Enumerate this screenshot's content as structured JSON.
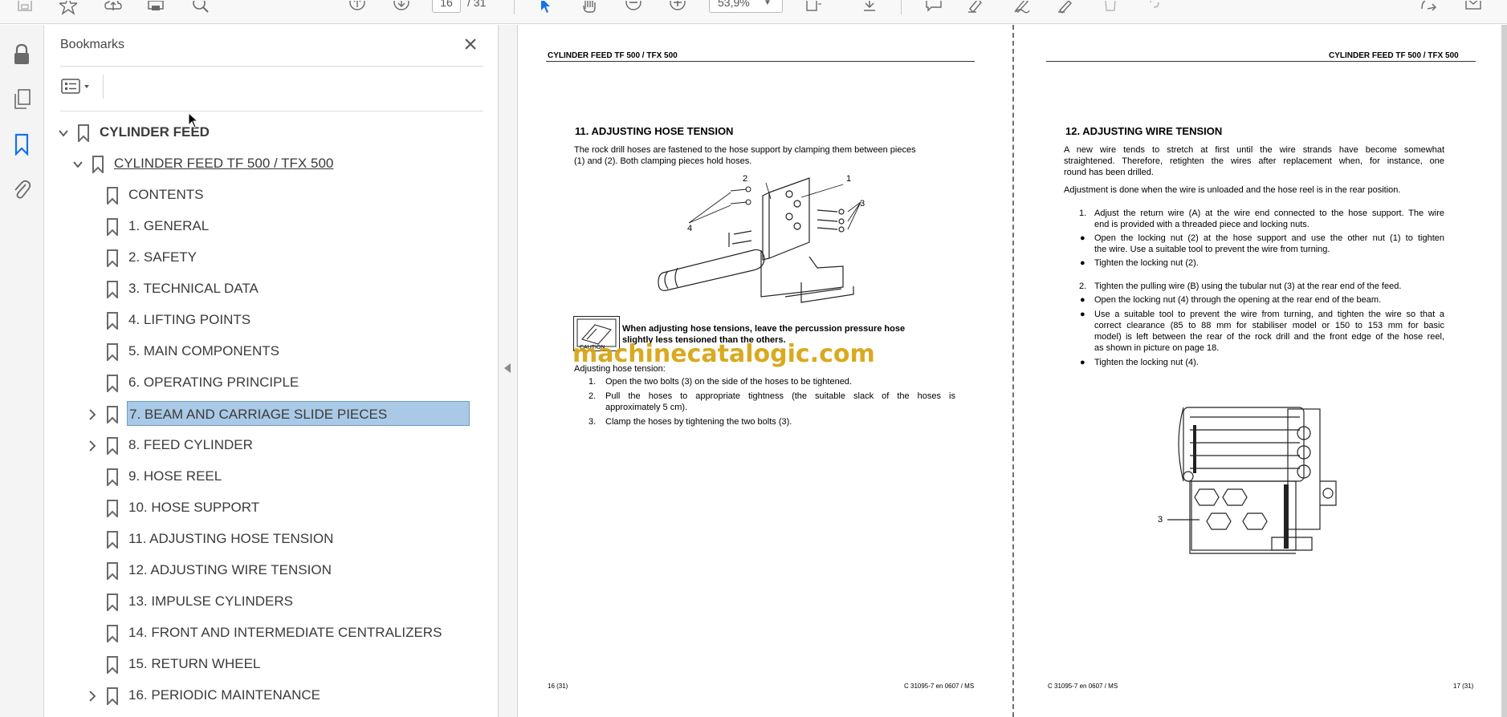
{
  "toolbar": {
    "page_current": "16",
    "page_total": "/ 31",
    "zoom": "53,9%"
  },
  "bookmarks_panel": {
    "title": "Bookmarks",
    "items": [
      {
        "label": "CYLINDER FEED",
        "level": 0,
        "expanded": true,
        "style": "bold"
      },
      {
        "label": "CYLINDER FEED TF 500 / TFX 500",
        "level": 1,
        "expanded": true,
        "style": "underline"
      },
      {
        "label": "CONTENTS",
        "level": 2
      },
      {
        "label": "1. GENERAL",
        "level": 2
      },
      {
        "label": "2. SAFETY",
        "level": 2
      },
      {
        "label": "3. TECHNICAL DATA",
        "level": 2
      },
      {
        "label": "4. LIFTING POINTS",
        "level": 2
      },
      {
        "label": "5. MAIN COMPONENTS",
        "level": 2
      },
      {
        "label": "6. OPERATING PRINCIPLE",
        "level": 2
      },
      {
        "label": "7. BEAM AND CARRIAGE SLIDE PIECES",
        "level": 2,
        "expandable": true,
        "selected": true
      },
      {
        "label": "8. FEED CYLINDER",
        "level": 2,
        "expandable": true
      },
      {
        "label": "9. HOSE REEL",
        "level": 2
      },
      {
        "label": "10. HOSE SUPPORT",
        "level": 2
      },
      {
        "label": "11. ADJUSTING HOSE TENSION",
        "level": 2
      },
      {
        "label": "12. ADJUSTING WIRE TENSION",
        "level": 2
      },
      {
        "label": "13. IMPULSE CYLINDERS",
        "level": 2
      },
      {
        "label": "14. FRONT AND INTERMEDIATE CENTRALIZERS",
        "level": 2
      },
      {
        "label": "15. RETURN WHEEL",
        "level": 2
      },
      {
        "label": "16. PERIODIC MAINTENANCE",
        "level": 2,
        "expandable": true
      }
    ]
  },
  "left_page": {
    "header": "CYLINDER FEED TF 500 / TFX 500",
    "section_title": "11.    ADJUSTING HOSE TENSION",
    "intro_lines": [
      "The rock drill hoses are fastened to the hose support by clamping them between pieces",
      "(1) and (2). Both clamping pieces hold hoses."
    ],
    "figure_callouts": [
      "1",
      "2",
      "3",
      "4"
    ],
    "caution_label": "CAUTION",
    "caution_lines": [
      "When adjusting hose tensions, leave the percussion pressure hose",
      "slightly less tensioned than the others."
    ],
    "procedure_title": "Adjusting hose tension:",
    "steps": [
      {
        "num": "1.",
        "lines": [
          "Open the two bolts (3) on the side of the hoses to be tightened."
        ]
      },
      {
        "num": "2.",
        "lines": [
          "Pull the hoses to appropriate tightness (the suitable slack of the hoses is",
          "approximately 5 cm)."
        ]
      },
      {
        "num": "3.",
        "lines": [
          "Clamp the hoses by tightening the two bolts (3)."
        ]
      }
    ],
    "footer_left": "16 (31)",
    "footer_right": "C 31095-7 en 0607  /  MS"
  },
  "right_page": {
    "header": "CYLINDER FEED TF 500 / TFX 500",
    "section_title": "12.    ADJUSTING WIRE TENSION",
    "intro_lines": [
      "A new wire tends to stretch at first until the wire strands have become somewhat",
      "straightened. Therefore, retighten the wires after replacement when, for instance, one",
      "round has been drilled."
    ],
    "intro2": "Adjustment is done when the wire is unloaded and the hose reel is in the rear position.",
    "step1": {
      "num": "1.",
      "lines": [
        "Adjust the return wire (A) at the wire end connected to the hose support. The wire",
        "end is provided with a threaded piece and locking nuts."
      ]
    },
    "step1_bullets": [
      [
        "Open the locking nut (2) at the hose support and use the other nut (1) to tighten",
        "the wire. Use a suitable tool to prevent the wire from turning."
      ],
      [
        "Tighten the locking nut (2)."
      ]
    ],
    "step2": {
      "num": "2.",
      "lines": [
        "Tighten the pulling wire (B) using the tubular nut (3) at the rear end of the feed."
      ]
    },
    "step2_bullets": [
      [
        "Open the locking nut (4) through the opening at the rear end of the beam."
      ],
      [
        "Use a suitable tool to prevent the wire from turning, and tighten the wire so that a",
        "correct clearance (85 to 88 mm for stabiliser model or 150 to 153 mm for basic",
        "model) is left between the rear of the rock drill and the front edge of the hose reel,",
        "as shown in picture on page 18."
      ],
      [
        "Tighten the locking nut (4)."
      ]
    ],
    "figure_callout": "3",
    "footer_left": "C 31095-7 en 0607  /  MS",
    "footer_right": "17 (31)"
  },
  "watermark": "machinecatalogic.com"
}
